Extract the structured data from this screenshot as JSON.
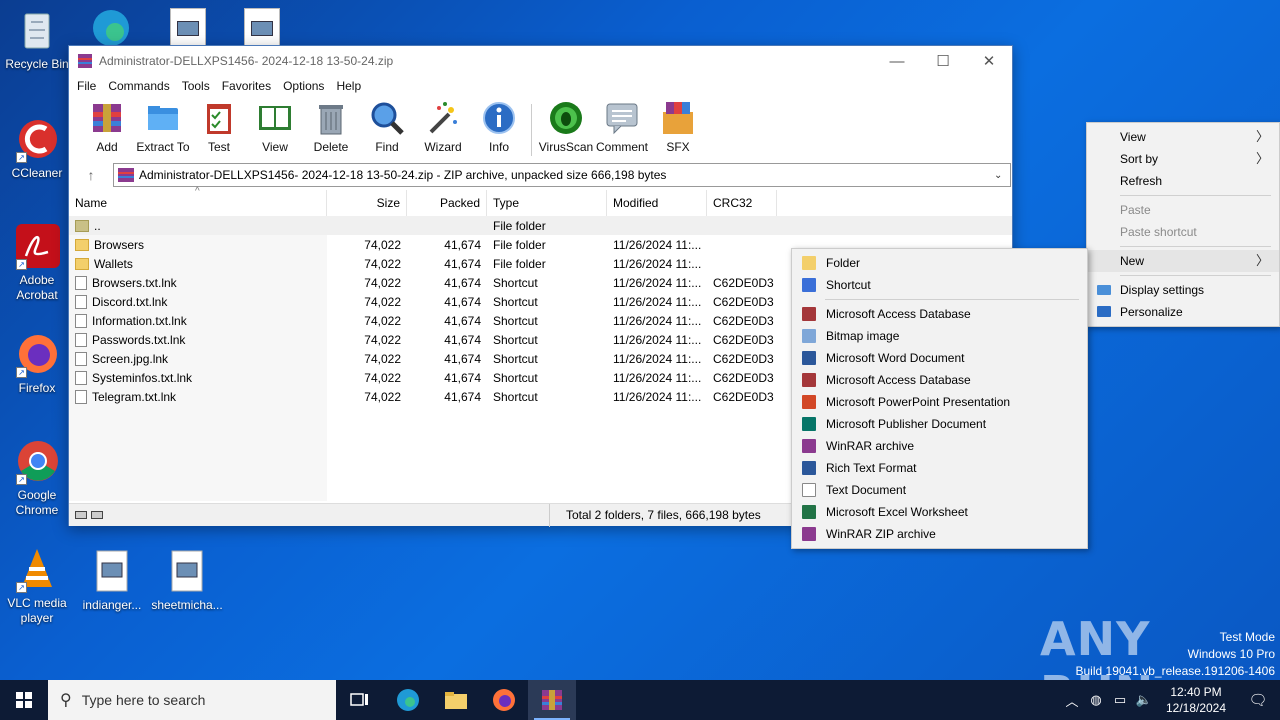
{
  "desktop": {
    "icons": [
      {
        "label": "Recycle Bin"
      },
      {
        "label": "CCleaner"
      },
      {
        "label": "Adobe Acrobat"
      },
      {
        "label": "Firefox"
      },
      {
        "label": "Google Chrome"
      },
      {
        "label": "VLC media player"
      },
      {
        "label": "indianger..."
      },
      {
        "label": "sheetmicha..."
      }
    ]
  },
  "window": {
    "title": "Administrator-DELLXPS1456- 2024-12-18 13-50-24.zip",
    "controls": {
      "minimize": "—",
      "maximize": "☐",
      "close": "✕"
    }
  },
  "menu": [
    "File",
    "Commands",
    "Tools",
    "Favorites",
    "Options",
    "Help"
  ],
  "toolbar": [
    "Add",
    "Extract To",
    "Test",
    "View",
    "Delete",
    "Find",
    "Wizard",
    "Info",
    "VirusScan",
    "Comment",
    "SFX"
  ],
  "address": {
    "text": "Administrator-DELLXPS1456- 2024-12-18 13-50-24.zip - ZIP archive, unpacked size 666,198 bytes"
  },
  "columns": {
    "name": "Name",
    "size": "Size",
    "packed": "Packed",
    "type": "Type",
    "modified": "Modified",
    "crc": "CRC32"
  },
  "files": [
    {
      "name": "..",
      "size": "",
      "packed": "",
      "type": "File folder",
      "modified": "",
      "crc": "",
      "kind": "up"
    },
    {
      "name": "Browsers",
      "size": "74,022",
      "packed": "41,674",
      "type": "File folder",
      "modified": "11/26/2024 11:...",
      "crc": "",
      "kind": "folder"
    },
    {
      "name": "Wallets",
      "size": "74,022",
      "packed": "41,674",
      "type": "File folder",
      "modified": "11/26/2024 11:...",
      "crc": "",
      "kind": "folder"
    },
    {
      "name": "Browsers.txt.lnk",
      "size": "74,022",
      "packed": "41,674",
      "type": "Shortcut",
      "modified": "11/26/2024 11:...",
      "crc": "C62DE0D3",
      "kind": "file"
    },
    {
      "name": "Discord.txt.lnk",
      "size": "74,022",
      "packed": "41,674",
      "type": "Shortcut",
      "modified": "11/26/2024 11:...",
      "crc": "C62DE0D3",
      "kind": "file"
    },
    {
      "name": "Information.txt.lnk",
      "size": "74,022",
      "packed": "41,674",
      "type": "Shortcut",
      "modified": "11/26/2024 11:...",
      "crc": "C62DE0D3",
      "kind": "file"
    },
    {
      "name": "Passwords.txt.lnk",
      "size": "74,022",
      "packed": "41,674",
      "type": "Shortcut",
      "modified": "11/26/2024 11:...",
      "crc": "C62DE0D3",
      "kind": "file"
    },
    {
      "name": "Screen.jpg.lnk",
      "size": "74,022",
      "packed": "41,674",
      "type": "Shortcut",
      "modified": "11/26/2024 11:...",
      "crc": "C62DE0D3",
      "kind": "file"
    },
    {
      "name": "Systeminfos.txt.lnk",
      "size": "74,022",
      "packed": "41,674",
      "type": "Shortcut",
      "modified": "11/26/2024 11:...",
      "crc": "C62DE0D3",
      "kind": "file"
    },
    {
      "name": "Telegram.txt.lnk",
      "size": "74,022",
      "packed": "41,674",
      "type": "Shortcut",
      "modified": "11/26/2024 11:...",
      "crc": "C62DE0D3",
      "kind": "file"
    }
  ],
  "status": {
    "total": "Total 2 folders, 7 files, 666,198 bytes"
  },
  "context_menu": {
    "items": [
      {
        "label": "View",
        "submenu": true
      },
      {
        "label": "Sort by",
        "submenu": true
      },
      {
        "label": "Refresh"
      },
      {
        "label": "Paste",
        "disabled": true
      },
      {
        "label": "Paste shortcut",
        "disabled": true
      },
      {
        "label": "New",
        "submenu": true,
        "highlighted": true
      },
      {
        "label": "Display settings"
      },
      {
        "label": "Personalize"
      }
    ]
  },
  "new_submenu": {
    "items": [
      {
        "label": "Folder",
        "color": "#f3cf6b"
      },
      {
        "label": "Shortcut",
        "color": "#3a6fd8"
      },
      {
        "label": "Microsoft Access Database",
        "color": "#a4373a"
      },
      {
        "label": "Bitmap image",
        "color": "#7fa7d8"
      },
      {
        "label": "Microsoft Word Document",
        "color": "#2b579a"
      },
      {
        "label": "Microsoft Access Database",
        "color": "#a4373a"
      },
      {
        "label": "Microsoft PowerPoint Presentation",
        "color": "#d24726"
      },
      {
        "label": "Microsoft Publisher Document",
        "color": "#077568"
      },
      {
        "label": "WinRAR archive",
        "color": "#8b3a8f"
      },
      {
        "label": "Rich Text Format",
        "color": "#2b579a"
      },
      {
        "label": "Text Document",
        "color": "#cccccc"
      },
      {
        "label": "Microsoft Excel Worksheet",
        "color": "#217346"
      },
      {
        "label": "WinRAR ZIP archive",
        "color": "#8b3a8f"
      }
    ]
  },
  "taskbar": {
    "search_placeholder": "Type here to search",
    "time": "12:40 PM",
    "date": "12/18/2024"
  },
  "watermark": {
    "line1": "Test Mode",
    "line2": "Windows 10 Pro",
    "line3": "Build 19041.vb_release.191206-1406",
    "brand": "ANY RUN"
  }
}
